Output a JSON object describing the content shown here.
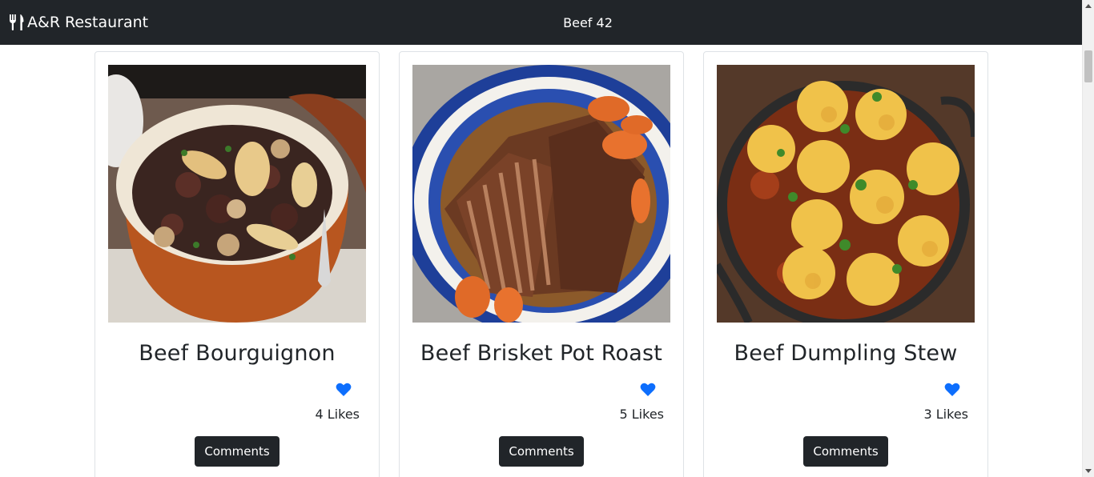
{
  "navbar": {
    "brand": "A&R Restaurant",
    "brand_icon": "utensils-icon",
    "category": "Beef 42"
  },
  "meals": [
    {
      "title": "Beef Bourguignon",
      "likes": "4 Likes",
      "comments_label": "Comments",
      "image": "beef-bourguignon-photo"
    },
    {
      "title": "Beef Brisket Pot Roast",
      "likes": "5 Likes",
      "comments_label": "Comments",
      "image": "beef-brisket-pot-roast-photo"
    },
    {
      "title": "Beef Dumpling Stew",
      "likes": "3 Likes",
      "comments_label": "Comments",
      "image": "beef-dumpling-stew-photo"
    }
  ],
  "colors": {
    "navbar_bg": "#212529",
    "like_heart": "#0d6efd",
    "button_bg": "#212529"
  }
}
